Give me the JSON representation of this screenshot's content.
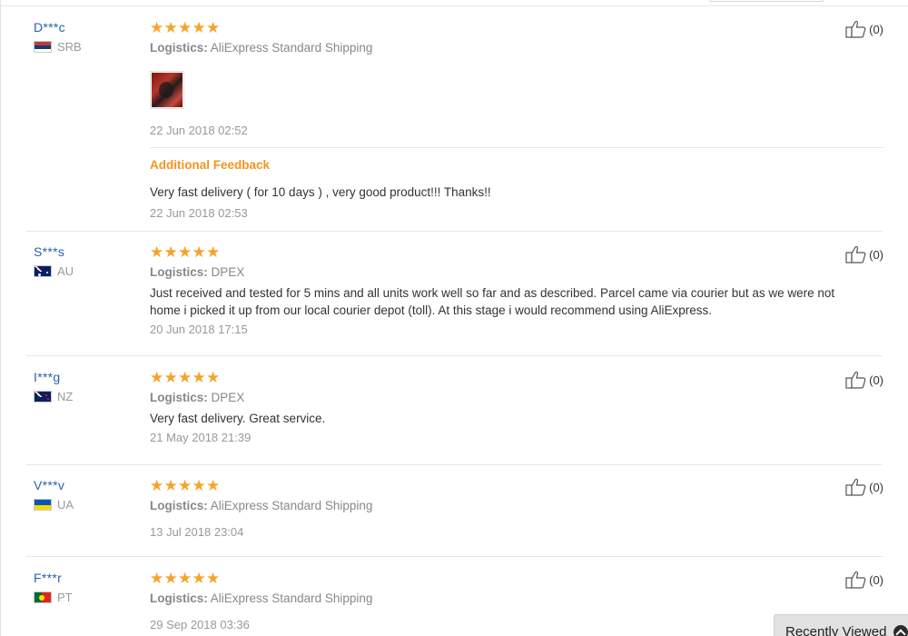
{
  "reviews": [
    {
      "user": "D***c",
      "country": "SRB",
      "flag": [
        "#c6363c",
        "#0c4076",
        "#ffffff"
      ],
      "logistics_label": "Logistics:",
      "logistics": "AliExpress Standard Shipping",
      "rating": 5,
      "has_photo": true,
      "photo_icon": "product-photo-thumbnail",
      "text": "",
      "date": "22 Jun 2018 02:52",
      "helpful": "(0)",
      "additional": {
        "title": "Additional Feedback",
        "text": "Very fast delivery ( for 10 days ) , very good product!!! Thanks!!",
        "date": "22 Jun 2018 02:53"
      }
    },
    {
      "user": "S***s",
      "country": "AU",
      "flag": [
        "#012169",
        "#012169",
        "#012169"
      ],
      "logistics_label": "Logistics:",
      "logistics": "DPEX",
      "rating": 5,
      "text_lines": [
        "Just received and tested for 5 mins and all units work well so far and as described. Parcel came via courier but as we were not",
        "home i picked it up from our local courier depot (toll). At this stage i would recommend using AliExpress."
      ],
      "date": "20 Jun 2018 17:15",
      "helpful": "(0)"
    },
    {
      "user": "I***g",
      "country": "NZ",
      "flag": [
        "#012169",
        "#012169",
        "#012169"
      ],
      "logistics_label": "Logistics:",
      "logistics": "DPEX",
      "rating": 5,
      "text": "Very fast delivery. Great service.",
      "date": "21 May 2018 21:39",
      "helpful": "(0)"
    },
    {
      "user": "V***v",
      "country": "UA",
      "flag": [
        "#0057b7",
        "#ffd700",
        "#ffd700"
      ],
      "logistics_label": "Logistics:",
      "logistics": "AliExpress Standard Shipping",
      "rating": 5,
      "text": "",
      "date": "13 Jul 2018 23:04",
      "helpful": "(0)"
    },
    {
      "user": "F***r",
      "country": "PT",
      "flag": [
        "#046a38",
        "#da291c",
        "#da291c"
      ],
      "logistics_label": "Logistics:",
      "logistics": "AliExpress Standard Shipping",
      "rating": 5,
      "text": "",
      "date": "29 Sep 2018 03:36",
      "helpful": "(0)"
    }
  ],
  "recently_viewed": {
    "label": "Recently Viewed",
    "icon": "chevron-up-circle-icon"
  },
  "colors": {
    "username": "#2a61b0",
    "star": "#f6a32b",
    "additional_feedback": "#f7941d",
    "muted": "#999999"
  }
}
